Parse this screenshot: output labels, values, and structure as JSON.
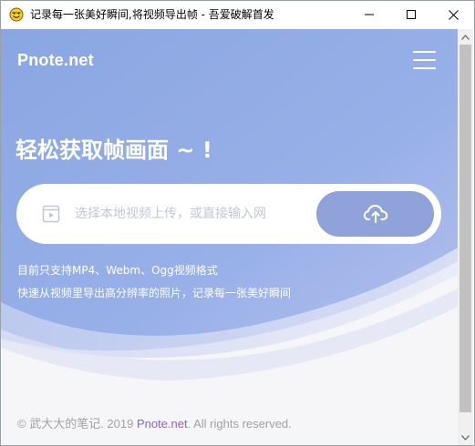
{
  "window": {
    "title": "记录每一张美好瞬间,将视频导出帧 - 吾爱破解首发",
    "app_icon": "smiley-face-icon",
    "buttons": {
      "minimize": "minimize-icon",
      "maximize": "maximize-icon",
      "close": "close-icon"
    }
  },
  "navbar": {
    "brand": "Pnote.net",
    "menu_icon": "hamburger-menu-icon"
  },
  "hero": {
    "title": "轻松获取帧画面 ~ !"
  },
  "upload": {
    "placeholder": "选择本地视频上传，或直接输入网",
    "value": "",
    "file_icon": "video-file-icon",
    "button_icon": "cloud-upload-icon"
  },
  "info": {
    "supported_formats": "目前只支持MP4、Webm、Ogg视频格式",
    "description": "快速从视频里导出高分辨率的照片，记录每一张美好瞬间"
  },
  "footer": {
    "prefix": "© 武大大的笔记. 2019 ",
    "link": "Pnote.net",
    "suffix": ". All rights reserved."
  },
  "colors": {
    "hero_gradient_start": "#8ba6e0",
    "hero_gradient_end": "#a9b8ec",
    "upload_button": "#8fa3da",
    "footer_link": "#8e61c8",
    "footer_text": "#a0a0a6"
  }
}
